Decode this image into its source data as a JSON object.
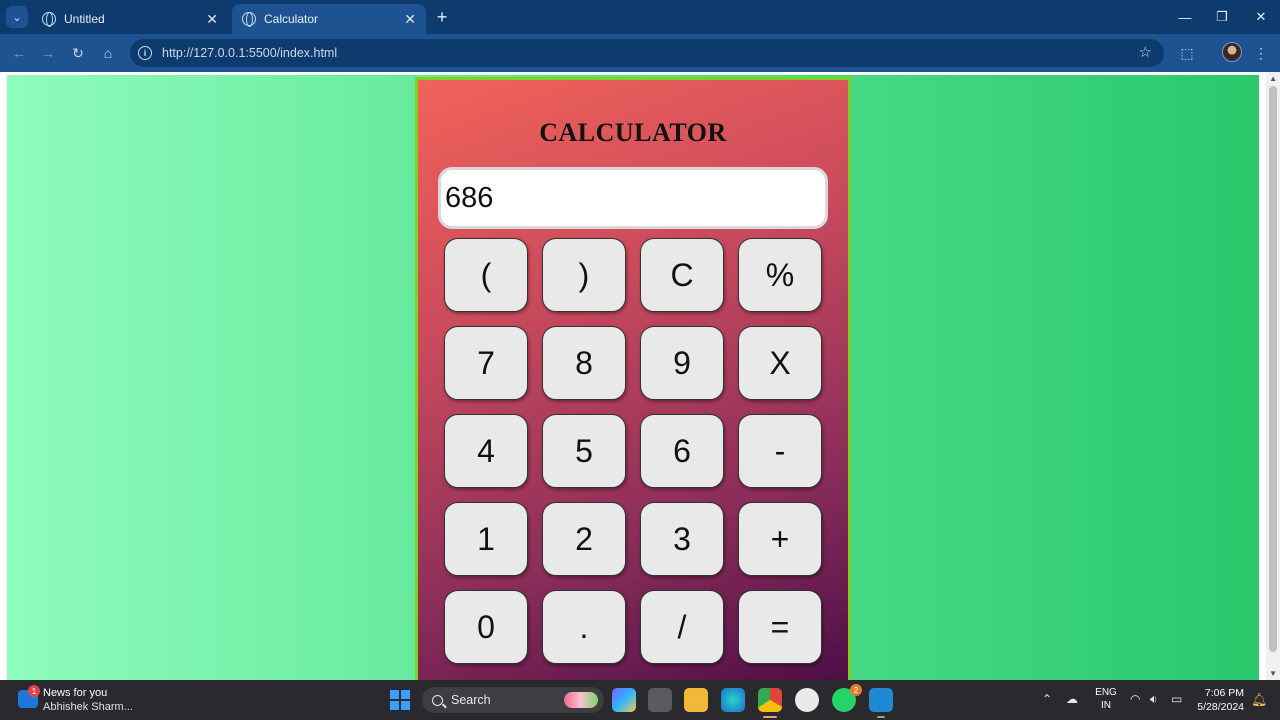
{
  "browser": {
    "tabs": [
      {
        "title": "Untitled",
        "active": false
      },
      {
        "title": "Calculator",
        "active": true
      }
    ],
    "url": "http://127.0.0.1:5500/index.html"
  },
  "page": {
    "title": "CALCULATOR",
    "display_value": "686",
    "keys": [
      "(",
      ")",
      "C",
      "%",
      "7",
      "8",
      "9",
      "X",
      "4",
      "5",
      "6",
      "-",
      "1",
      "2",
      "3",
      "+",
      "0",
      ".",
      "/",
      "="
    ],
    "colors": {
      "background_left": "#8ffcbc",
      "background_right": "#29c96c",
      "panel_top": "#f2625a",
      "panel_bottom": "#4a0d45",
      "panel_border": "#7ed321",
      "key_fill": "#e9e9e9"
    }
  },
  "taskbar": {
    "news_title": "News for you",
    "news_subtitle": "Abhishek Sharm...",
    "news_badge": "1",
    "search_label": "Search",
    "whatsapp_badge": "2",
    "lang_line1": "ENG",
    "lang_line2": "IN",
    "time": "7:06 PM",
    "date": "5/28/2024"
  }
}
